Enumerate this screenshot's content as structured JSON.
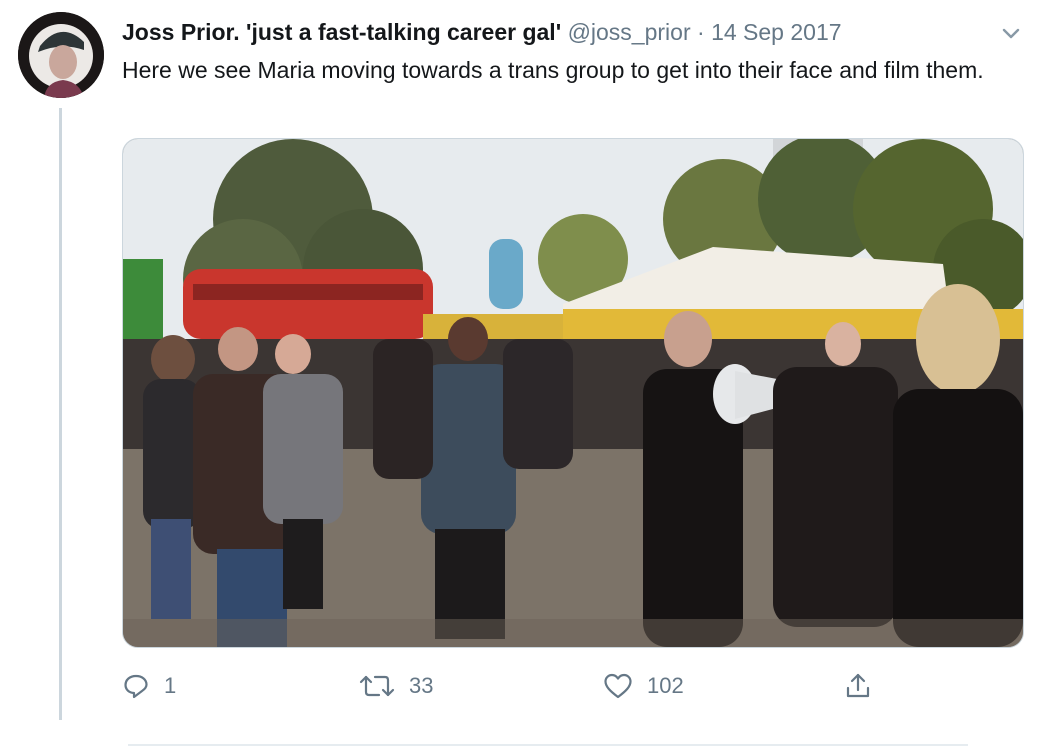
{
  "tweet": {
    "display_name": "Joss Prior. 'just a fast-talking career gal'",
    "handle": "@joss_prior",
    "separator": "·",
    "date": "14 Sep 2017",
    "text": "Here we see Maria moving towards a trans group to get into their face and film them.",
    "media_alt": "Photo of a crowd gathered outdoors in a park near a red double-decker bus, a person in black holding a megaphone"
  },
  "actions": {
    "reply": {
      "icon": "reply-icon",
      "count": "1"
    },
    "retweet": {
      "icon": "retweet-icon",
      "count": "33"
    },
    "like": {
      "icon": "heart-icon",
      "count": "102"
    },
    "share": {
      "icon": "share-icon"
    }
  },
  "colors": {
    "text": "#14171a",
    "secondary": "#657786",
    "border": "#ccd6dd"
  }
}
